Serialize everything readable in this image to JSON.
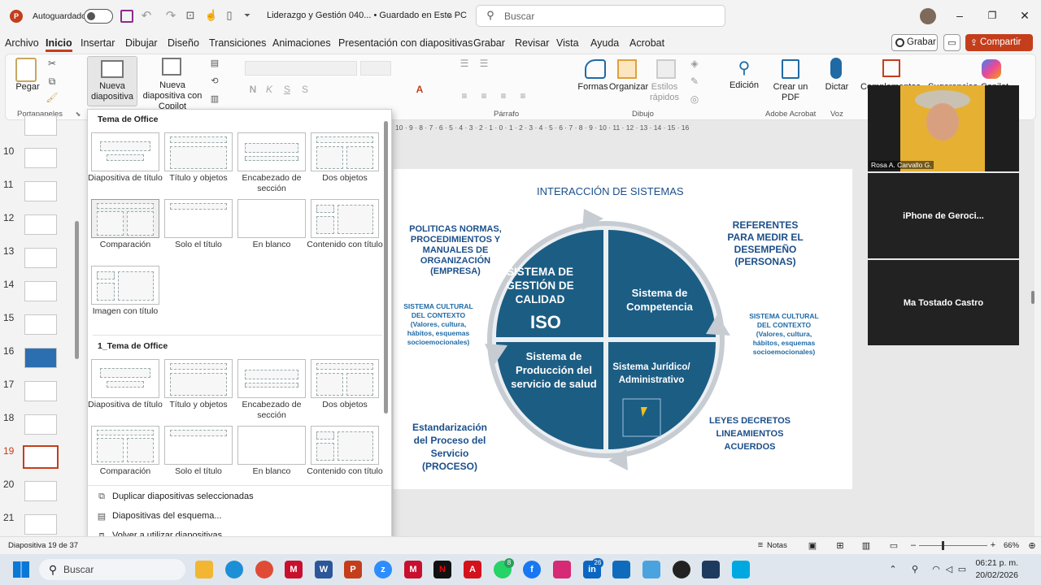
{
  "titlebar": {
    "autosave": "Autoguardado",
    "doc_title": "Liderazgo y Gestión 040... • Guardado en Este PC",
    "search_placeholder": "Buscar"
  },
  "tabs": [
    "Archivo",
    "Inicio",
    "Insertar",
    "Dibujar",
    "Diseño",
    "Transiciones",
    "Animaciones",
    "Presentación con diapositivas",
    "Grabar",
    "Revisar",
    "Vista",
    "Ayuda",
    "Acrobat"
  ],
  "tabs_right": {
    "record": "Grabar",
    "share": "Compartir"
  },
  "ribbon": {
    "paste": "Pegar",
    "clipboard_group": "Portapapeles",
    "new_slide": "Nueva diapositiva",
    "new_slide_copilot": "Nueva diapositiva con Copilot",
    "paragraph_group": "Párrafo",
    "shapes": "Formas",
    "arrange": "Organizar",
    "quick_styles": "Estilos rápidos",
    "drawing_group": "Dibujo",
    "editing": "Edición",
    "create_pdf": "Crear un PDF",
    "acrobat_group": "Adobe Acrobat",
    "dictate": "Dictar",
    "voice_group": "Voz",
    "addins": "Complementos",
    "suggestions": "Sugerencias",
    "copilot": "Copilot"
  },
  "dropdown": {
    "section1": "Tema de Office",
    "section2": "1_Tema de Office",
    "layouts": [
      "Diapositiva de título",
      "Título y objetos",
      "Encabezado de sección",
      "Dos objetos",
      "Comparación",
      "Solo el título",
      "En blanco",
      "Contenido con título",
      "Imagen con título"
    ],
    "menu": [
      "Duplicar diapositivas seleccionadas",
      "Diapositivas del esquema...",
      "Volver a utilizar diapositivas..."
    ]
  },
  "thumbs": [
    "10",
    "11",
    "12",
    "13",
    "14",
    "15",
    "16",
    "17",
    "18",
    "19",
    "20",
    "21"
  ],
  "slide": {
    "title": "INTERACCIÓN DE SISTEMAS",
    "q1": "SISTEMA DE GESTIÓN DE CALIDAD",
    "q1b": "ISO",
    "q2": "Sistema de Competencia",
    "q3": "Sistema de Producción del servicio de salud",
    "q4": "Sistema Jurídico/ Administrativo",
    "left_top": "POLITICAS NORMAS, PROCEDIMIENTOS Y MANUALES DE ORGANIZACIÓN (EMPRESA)",
    "right_top": "REFERENTES PARA MEDIR EL DESEMPEÑO (PERSONAS)",
    "left_mid": "SISTEMA CULTURAL DEL CONTEXTO (Valores, cultura, hábitos, esquemas socioemocionales)",
    "right_mid": "SISTEMA CULTURAL DEL CONTEXTO (Valores, cultura, hábitos, esquemas socioemocionales)",
    "left_bottom": "Estandarización del Proceso del Servicio (PROCESO)",
    "right_bottom": "LEYES DECRETOS LINEAMIENTOS ACUERDOS"
  },
  "video": {
    "p1": "Rosa A. Carvallo G.",
    "p2": "iPhone de Geroci...",
    "p3": "Ma Tostado Castro"
  },
  "ruler": "10 · 9 · 8 · 7 · 6 · 5 · 4 · 3 · 2 · 1 · 0 · 1 · 2 · 3 · 4 · 5 · 6 · 7 · 8 · 9 · 10 · 11 · 12 · 13 · 14 · 15 · 16",
  "status": {
    "slide_info": "Diapositiva 19 de 37",
    "notes": "Notas",
    "zoom": "66%"
  },
  "taskbar": {
    "search": "Buscar",
    "time": "06:21 p. m.",
    "date": "20/02/2026",
    "badge_whatsapp": "8",
    "badge_linkedin": "26"
  },
  "colors": {
    "accent": "#c43e1c",
    "blue": "#1f6aa5",
    "navy": "#1b4f8a",
    "quadrant": "#1c5d84"
  }
}
